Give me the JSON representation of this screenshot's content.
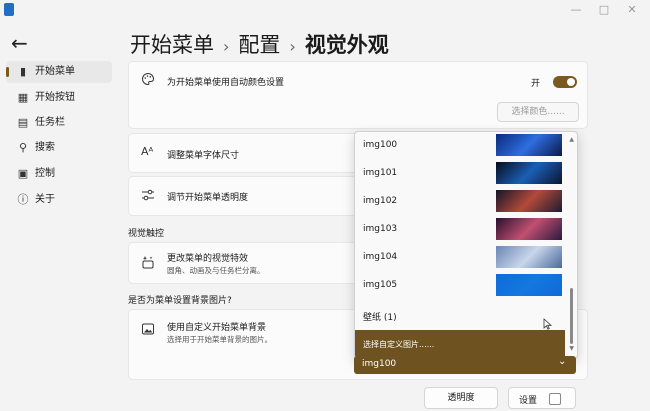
{
  "window": {
    "minimize": "—",
    "maximize": "□",
    "close": "✕"
  },
  "header": {
    "back_icon": "←",
    "breadcrumb": [
      "开始菜单",
      "配置",
      "视觉外观"
    ],
    "separator": "›"
  },
  "sidebar": {
    "items": [
      {
        "label": "开始菜单",
        "icon": "▮",
        "active": true
      },
      {
        "label": "开始按钮",
        "icon": "▦",
        "active": false
      },
      {
        "label": "任务栏",
        "icon": "▤",
        "active": false
      },
      {
        "label": "搜索",
        "icon": "⚲",
        "active": false
      },
      {
        "label": "控制",
        "icon": "▣",
        "active": false
      },
      {
        "label": "关于",
        "icon": "ⓘ",
        "active": false
      }
    ]
  },
  "main": {
    "auto_color": {
      "icon": "palette-icon",
      "title": "为开始菜单使用自动颜色设置",
      "toggle_label": "开",
      "toggle_on": true,
      "choose_color": "选择颜色......"
    },
    "font_size": {
      "icon": "Aᴬ",
      "title": "调整菜单字体尺寸"
    },
    "transparency": {
      "icon": "sliders-icon",
      "title": "调节开始菜单透明度"
    },
    "visual_effects_section": "视觉触控",
    "visual_effects": {
      "icon": "sparkle-icon",
      "title": "更改菜单的视觉特效",
      "subtitle": "圆角、动画及与任务栏分离。"
    },
    "background_section": "是否为菜单设置背景图片?",
    "custom_bg": {
      "icon": "image-icon",
      "title": "使用自定义开始菜单背景",
      "subtitle": "选择用于开始菜单背景的图片。"
    },
    "transparency_button": "透明度",
    "settings_button": "设置"
  },
  "dropdown": {
    "items": [
      {
        "label": "img100",
        "thumb": [
          "#0b2a7a",
          "#2f6de0",
          "#0a1a4a"
        ]
      },
      {
        "label": "img101",
        "thumb": [
          "#050d1e",
          "#1a5fb4",
          "#0a1530"
        ]
      },
      {
        "label": "img102",
        "thumb": [
          "#141428",
          "#b34a3a",
          "#1c1c30"
        ]
      },
      {
        "label": "img103",
        "thumb": [
          "#2a0f2e",
          "#c05070",
          "#2a1a40"
        ]
      },
      {
        "label": "img104",
        "thumb": [
          "#6a86b4",
          "#c8d6ea",
          "#4a6a9a"
        ]
      },
      {
        "label": "img105",
        "thumb": [
          "#0f6ad8",
          "#1478e0",
          "#0f6ad8"
        ]
      }
    ],
    "wallpaper_item": "壁纸 (1)",
    "custom_item": "选择自定义图片......",
    "combo_value": "img100",
    "combo_chevron": "⌄"
  }
}
